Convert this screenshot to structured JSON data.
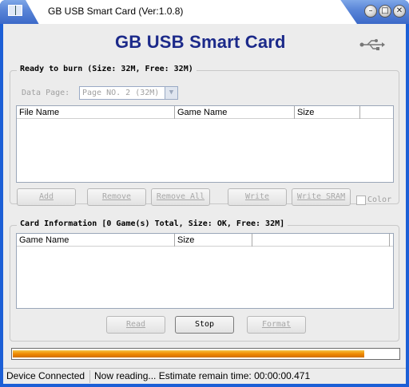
{
  "window": {
    "title": "GB USB Smart Card (Ver:1.0.8)"
  },
  "brand": {
    "heading": "GB USB Smart Card",
    "usb_icon": "usb-trident-icon"
  },
  "burn_group": {
    "label": "Ready to burn (Size: 32M, Free: 32M)",
    "data_page_label": "Data Page:",
    "data_page_value": "Page NO. 2 (32M)",
    "columns": [
      "File Name",
      "Game Name",
      "Size"
    ],
    "rows": []
  },
  "burn_buttons": {
    "add": "Add",
    "remove": "Remove",
    "remove_all": "Remove All",
    "write": "Write",
    "write_sram": "Write SRAM",
    "color_label": "Color"
  },
  "card_group": {
    "label": "Card Information [0 Game(s) Total, Size: OK, Free: 32M]",
    "columns": [
      "Game Name",
      "Size"
    ],
    "rows": []
  },
  "card_buttons": {
    "read": "Read",
    "stop": "Stop",
    "format": "Format"
  },
  "progress": {
    "fraction": 0.91
  },
  "status": {
    "connection": "Device Connected",
    "message": "Now reading...  Estimate remain time: 00:00:00.471"
  },
  "colors": {
    "title_bar": "#5a86d8",
    "brand_text": "#1c2a8a",
    "progress": "#f08a00",
    "window_bg": "#ececec"
  }
}
